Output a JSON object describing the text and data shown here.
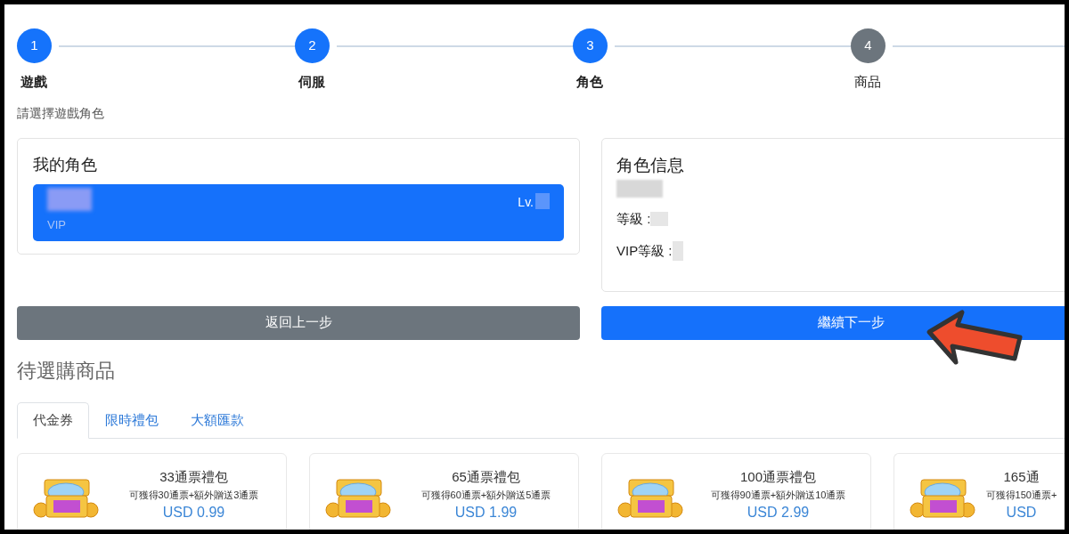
{
  "steps": [
    {
      "number": "1",
      "label": "遊戲",
      "completed": true
    },
    {
      "number": "2",
      "label": "伺服",
      "completed": true
    },
    {
      "number": "3",
      "label": "角色",
      "completed": true
    },
    {
      "number": "4",
      "label": "商品",
      "completed": false
    }
  ],
  "prompt": "請選擇遊戲角色",
  "my_roles": {
    "title": "我的角色",
    "roles": [
      {
        "level_label": "Lv.",
        "vip_label": "VIP",
        "selected": true
      }
    ]
  },
  "role_info": {
    "title": "角色信息",
    "fields": [
      {
        "label": "等級 :"
      },
      {
        "label": "VIP等級 :"
      }
    ]
  },
  "buttons": {
    "back": "返回上一步",
    "next": "繼續下一步"
  },
  "products": {
    "title": "待選購商品",
    "tabs": [
      {
        "label": "代金券",
        "selected": true
      },
      {
        "label": "限時禮包",
        "selected": false
      },
      {
        "label": "大額匯款",
        "selected": false
      }
    ],
    "items": [
      {
        "name": "33通票禮包",
        "desc": "可獲得30通票+額外贈送3通票",
        "price": "USD 0.99"
      },
      {
        "name": "65通票禮包",
        "desc": "可獲得60通票+額外贈送5通票",
        "price": "USD 1.99"
      },
      {
        "name": "100通票禮包",
        "desc": "可獲得90通票+額外贈送10通票",
        "price": "USD 2.99"
      },
      {
        "name": "165通",
        "desc": "可獲得150通票+",
        "price": "USD"
      }
    ]
  }
}
